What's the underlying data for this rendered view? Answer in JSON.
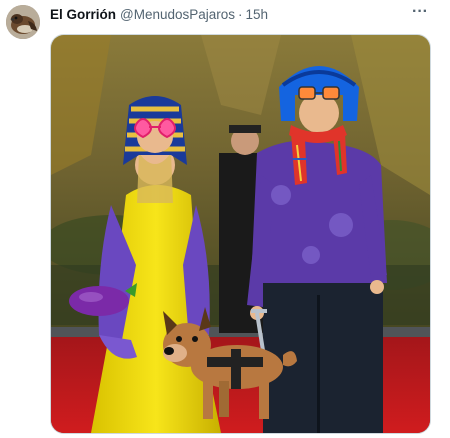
{
  "tweet": {
    "display_name": "El Gorrión",
    "handle": "@MenudosPajaros",
    "separator": "·",
    "timestamp": "15h",
    "more_icon": "more-horizontal-icon",
    "more_glyph": "···"
  },
  "media": {
    "kind": "photo",
    "stickers": [
      "pharaoh-headdress",
      "heart-sunglasses",
      "blue-bob-wig",
      "plaid-scarf",
      "eggplant-emoji",
      "guide-dog-emoji"
    ]
  },
  "colors": {
    "name_text": "#0f1419",
    "secondary_text": "#536471",
    "media_border": "#cfd9de",
    "carpet_red": "#c8161a",
    "dress_yellow": "#f2dc06",
    "shirt_purple": "#5b3aa8"
  }
}
